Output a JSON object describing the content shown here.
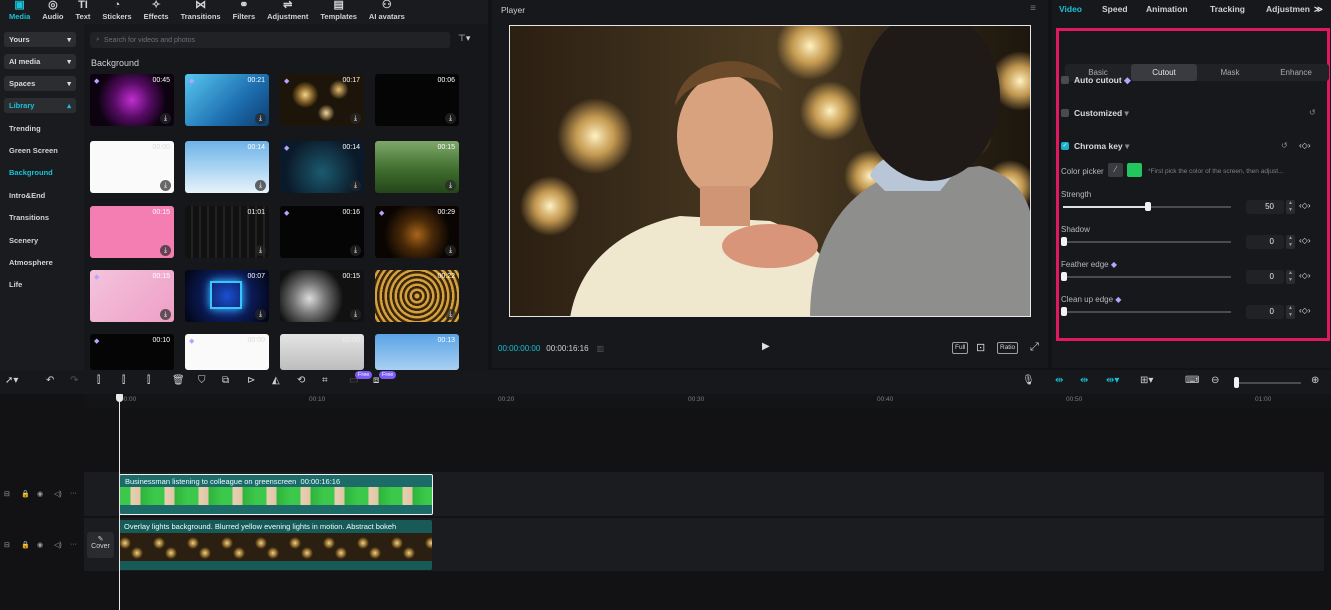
{
  "toolbar": {
    "items": [
      {
        "label": "Media",
        "icon": "media-icon"
      },
      {
        "label": "Audio",
        "icon": "audio-icon"
      },
      {
        "label": "Text",
        "icon": "text-icon"
      },
      {
        "label": "Stickers",
        "icon": "stickers-icon"
      },
      {
        "label": "Effects",
        "icon": "effects-icon"
      },
      {
        "label": "Transitions",
        "icon": "transitions-icon"
      },
      {
        "label": "Filters",
        "icon": "filters-icon"
      },
      {
        "label": "Adjustment",
        "icon": "adjustment-icon"
      },
      {
        "label": "Templates",
        "icon": "templates-icon"
      },
      {
        "label": "AI avatars",
        "icon": "ai-avatars-icon"
      }
    ]
  },
  "sidebar": {
    "dropdowns": [
      "Yours",
      "AI media",
      "Spaces",
      "Library"
    ],
    "categories": [
      "Trending",
      "Green Screen",
      "Background",
      "Intro&End",
      "Transitions",
      "Scenery",
      "Atmosphere",
      "Life"
    ],
    "selected": "Background"
  },
  "media": {
    "search_placeholder": "Search for videos and photos",
    "section_title": "Background",
    "durations": [
      "00:45",
      "00:21",
      "00:17",
      "00:06",
      "00:00",
      "00:14",
      "00:14",
      "00:15",
      "00:15",
      "01:01",
      "00:16",
      "00:29",
      "00:15",
      "00:07",
      "00:15",
      "00:22",
      "00:10",
      "00:00",
      "00:00",
      "00:13"
    ]
  },
  "player": {
    "title": "Player",
    "current_time": "00:00:00:00",
    "total_time": "00:00:16:16",
    "btn_full": "Full",
    "btn_ratio": "Ratio"
  },
  "inspector": {
    "tabs": [
      "Video",
      "Speed",
      "Animation",
      "Tracking",
      "Adjustmen"
    ],
    "subtabs": [
      "Basic",
      "Cutout",
      "Mask",
      "Enhance"
    ],
    "auto_cutout": "Auto cutout",
    "customized": "Customized",
    "chroma_key": "Chroma key",
    "color_picker": "Color picker",
    "picker_hint": "*First pick the color of the screen, then adjust...",
    "picked_color": "#22c55e",
    "sliders": [
      {
        "label": "Strength",
        "value": "50",
        "fraction": 0.5
      },
      {
        "label": "Shadow",
        "value": "0",
        "fraction": 0
      },
      {
        "label": "Feather edge",
        "value": "0",
        "fraction": 0
      },
      {
        "label": "Clean up edge",
        "value": "0",
        "fraction": 0
      }
    ]
  },
  "timeline": {
    "free_badge": "Free",
    "ticks": [
      "00:00",
      "00:10",
      "00:20",
      "00:30",
      "00:40",
      "00:50",
      "01:00"
    ],
    "clip1_name": "Businessman listening to colleague on greenscreen",
    "clip1_duration": "00:00:16:16",
    "clip2_name": "Overlay lights background. Blurred yellow evening lights in motion. Abstract bokeh",
    "cover_label": "Cover"
  },
  "colors": {
    "accent": "#19c1d6",
    "highlight": "#e0185f"
  }
}
